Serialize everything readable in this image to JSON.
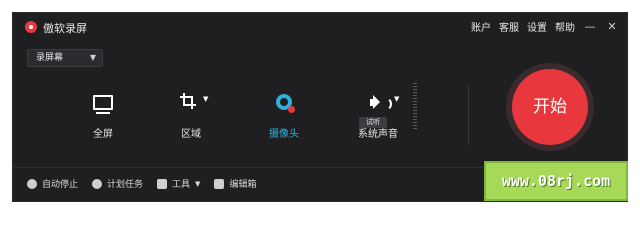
{
  "window": {
    "title": "傲软录屏"
  },
  "topmenu": {
    "account": "账户",
    "service": "客服",
    "settings": "设置",
    "help": "帮助",
    "minimize": "—",
    "close": "✕"
  },
  "mode_dropdown": {
    "value": "录屏幕",
    "caret": "▼"
  },
  "tools": {
    "fullscreen": {
      "label": "全屏",
      "icon": "monitor-icon"
    },
    "region": {
      "label": "区域",
      "icon": "crop-icon",
      "caret": "▼"
    },
    "camera": {
      "label": "摄像头",
      "icon": "camera-icon",
      "active": true
    },
    "sound": {
      "label": "系统声音",
      "icon": "speaker-icon",
      "caret": "▼",
      "test_button": "试听"
    }
  },
  "record_button": {
    "label": "开始"
  },
  "bottom_bar": {
    "auto_stop": "自动停止",
    "scheduled_task": "计划任务",
    "tools": "工具",
    "tools_caret": "▼",
    "editor": "编辑箱"
  },
  "watermark": {
    "text": "www.08rj.com"
  },
  "colors": {
    "accent": "#2db1d8",
    "record": "#e8383d",
    "background": "#1f1f22",
    "watermark": "#a8d858"
  }
}
